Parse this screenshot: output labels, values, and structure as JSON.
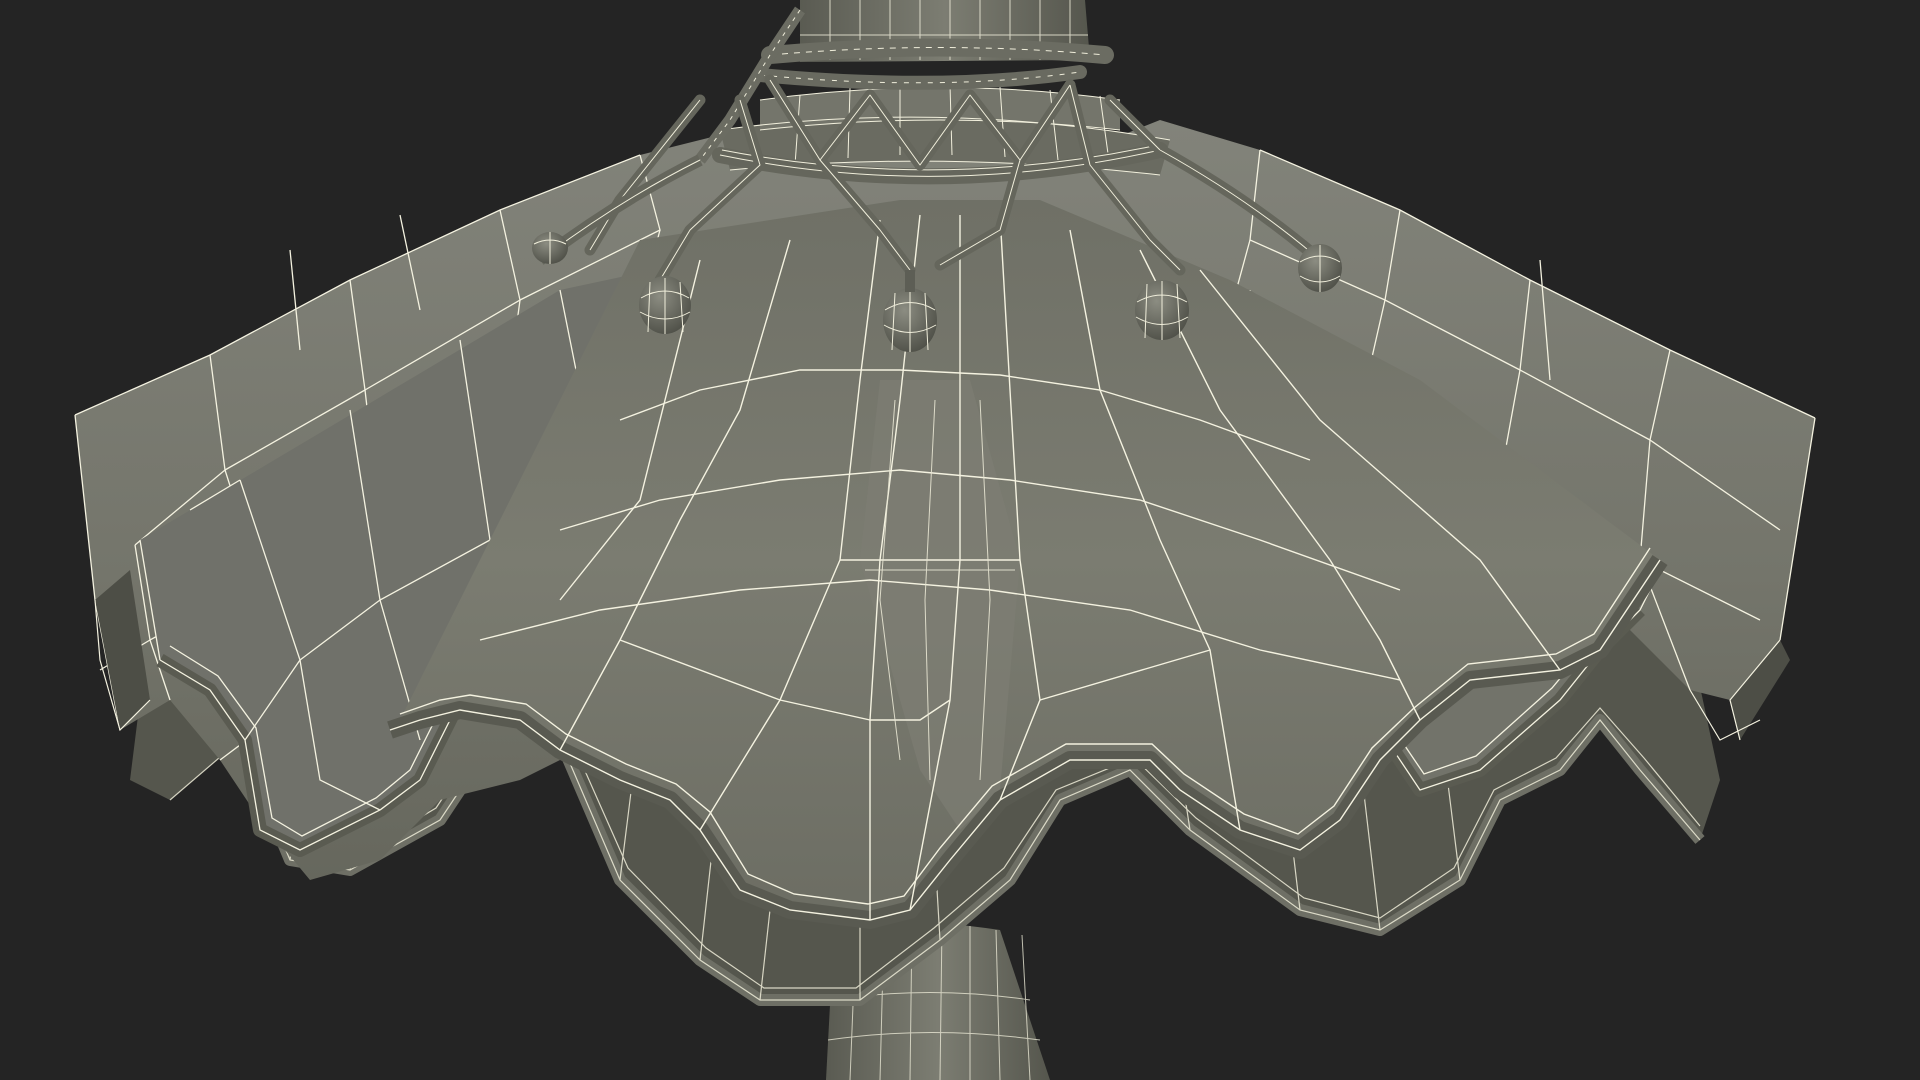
{
  "scene": {
    "subject": "lampshade-wireframe-render",
    "background_color": "#242424",
    "surface_color": "#75766a",
    "surface_shadow_color": "#5a5b51",
    "surface_dark_color": "#3c3d37",
    "wire_color": "#f2f0df",
    "icons": [
      "lamp-stem",
      "lampshade-outer-layer",
      "lampshade-inner-layer",
      "bead-necklace",
      "tassel-drops"
    ]
  }
}
